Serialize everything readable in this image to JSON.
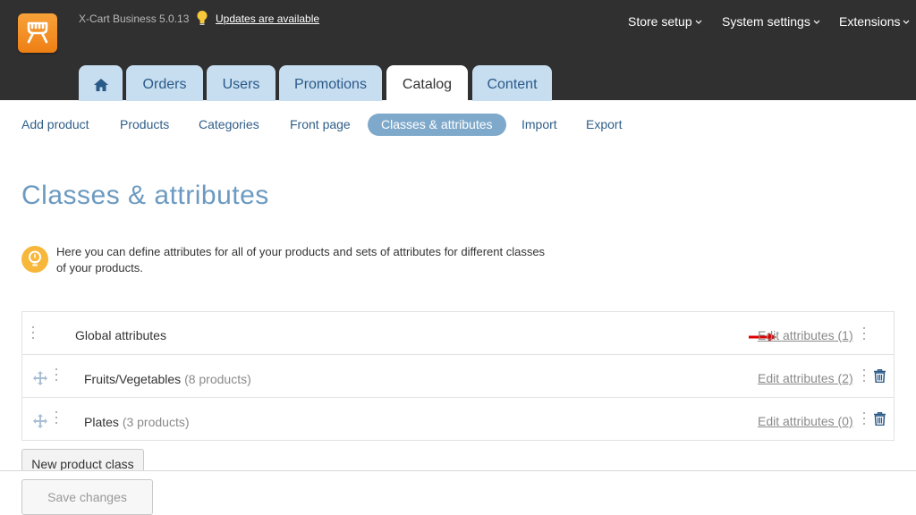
{
  "header": {
    "version": "X-Cart Business 5.0.13",
    "updates_link": "Updates are available",
    "menus": [
      {
        "label": "Store setup"
      },
      {
        "label": "System settings"
      },
      {
        "label": "Extensions"
      }
    ]
  },
  "tabs": [
    {
      "label": "Orders"
    },
    {
      "label": "Users"
    },
    {
      "label": "Promotions"
    },
    {
      "label": "Catalog",
      "active": true
    },
    {
      "label": "Content"
    }
  ],
  "subnav": [
    {
      "label": "Add product"
    },
    {
      "label": "Products"
    },
    {
      "label": "Categories"
    },
    {
      "label": "Front page"
    },
    {
      "label": "Classes & attributes",
      "active": true
    },
    {
      "label": "Import"
    },
    {
      "label": "Export"
    }
  ],
  "page": {
    "title": "Classes & attributes",
    "info": "Here you can define attributes for all of your products and sets of attributes for different classes of your products."
  },
  "classes": [
    {
      "name": "Global attributes",
      "count": "",
      "edit": "Edit attributes (1)"
    },
    {
      "name": "Fruits/Vegetables",
      "count": "(8 products)",
      "edit": "Edit attributes (2)"
    },
    {
      "name": "Plates",
      "count": "(3 products)",
      "edit": "Edit attributes (0)"
    }
  ],
  "buttons": {
    "new_class": "New product class",
    "save": "Save changes"
  },
  "colors": {
    "header_bg": "#303030",
    "accent": "#7fa9cb",
    "logo": "#ee7f14",
    "arrow": "#e00000"
  }
}
